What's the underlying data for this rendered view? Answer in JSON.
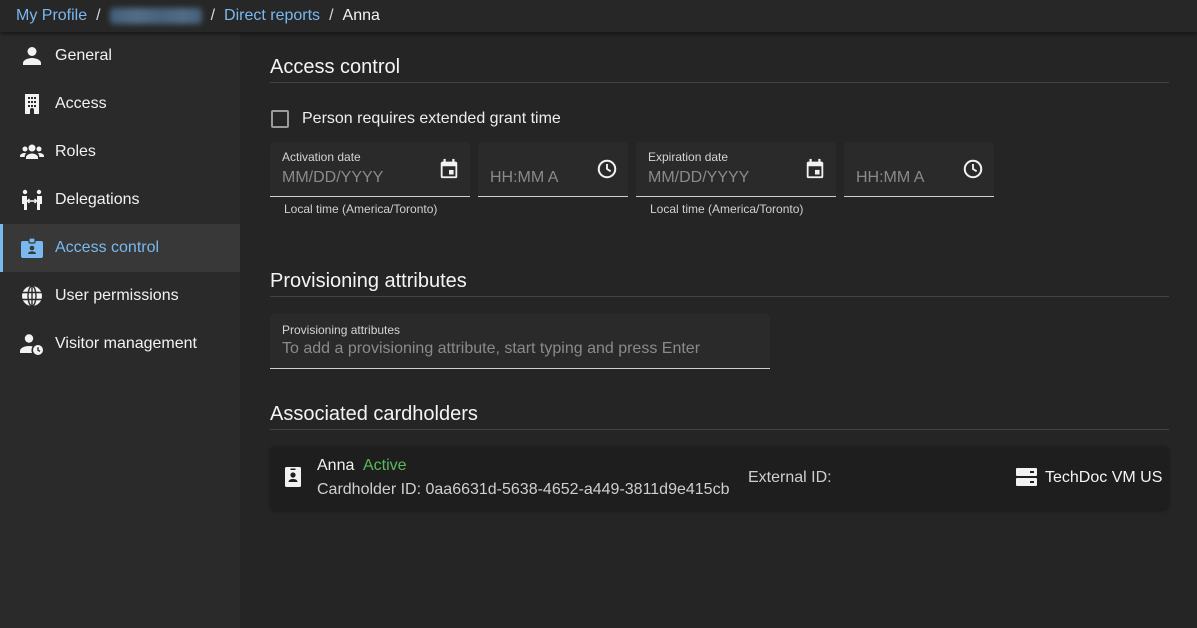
{
  "breadcrumb": {
    "items": [
      {
        "label": "My Profile",
        "link": true
      },
      {
        "label": "",
        "blurred": true
      },
      {
        "label": "Direct reports",
        "link": true
      },
      {
        "label": "Anna",
        "current": true
      }
    ],
    "separator": "/"
  },
  "sidebar": {
    "items": [
      {
        "label": "General",
        "icon": "person-icon"
      },
      {
        "label": "Access",
        "icon": "building-icon"
      },
      {
        "label": "Roles",
        "icon": "group-icon"
      },
      {
        "label": "Delegations",
        "icon": "delegation-icon"
      },
      {
        "label": "Access control",
        "icon": "badge-icon",
        "active": true
      },
      {
        "label": "User permissions",
        "icon": "globe-icon"
      },
      {
        "label": "Visitor management",
        "icon": "person-clock-icon"
      }
    ]
  },
  "access_control": {
    "title": "Access control",
    "extended_grant": {
      "label": "Person requires extended grant time",
      "checked": false
    },
    "activation": {
      "date_label": "Activation date",
      "date_placeholder": "MM/DD/YYYY",
      "time_placeholder": "HH:MM A",
      "hint": "Local time (America/Toronto)"
    },
    "expiration": {
      "date_label": "Expiration date",
      "date_placeholder": "MM/DD/YYYY",
      "time_placeholder": "HH:MM A",
      "hint": "Local time (America/Toronto)"
    }
  },
  "provisioning": {
    "title": "Provisioning attributes",
    "field_label": "Provisioning attributes",
    "placeholder": "To add a provisioning attribute, start typing and press Enter",
    "value": ""
  },
  "cardholders": {
    "title": "Associated cardholders",
    "items": [
      {
        "name": "Anna",
        "status": "Active",
        "status_color": "#5cb85c",
        "cardholder_id": "Cardholder ID: 0aa6631d-5638-4652-a449-3811d9e415cb",
        "external_id": "External ID:",
        "server": "TechDoc VM US"
      }
    ]
  },
  "colors": {
    "accent": "#7ab8ef",
    "background": "#252525",
    "sidebar": "#2a2a2a"
  }
}
